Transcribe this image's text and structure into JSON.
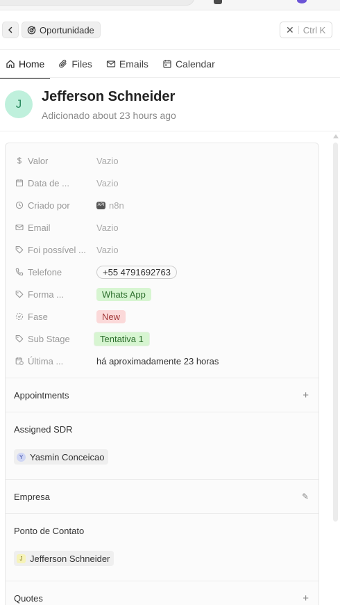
{
  "header": {
    "back_glyph": "‹",
    "breadcrumb_label": "Oportunidade",
    "close_glyph": "✕",
    "close_shortcut": "Ctrl K"
  },
  "tabs": [
    {
      "label": "Home",
      "icon": "home-icon"
    },
    {
      "label": "Files",
      "icon": "paperclip-icon"
    },
    {
      "label": "Emails",
      "icon": "mail-icon"
    },
    {
      "label": "Calendar",
      "icon": "calendar-icon"
    }
  ],
  "record": {
    "initial": "J",
    "name": "Jefferson Schneider",
    "subtitle": "Adicionado about 23 hours ago"
  },
  "fields": [
    {
      "label": "Valor",
      "value": "Vazio",
      "icon": "dollar-icon"
    },
    {
      "label": "Data de ...",
      "value": "Vazio",
      "icon": "calendar-icon"
    },
    {
      "label": "Criado por",
      "value": "n8n",
      "icon": "history-icon",
      "badge": "API"
    },
    {
      "label": "Email",
      "value": "Vazio",
      "icon": "mail-icon"
    },
    {
      "label": "Foi possível ...",
      "value": "Vazio",
      "icon": "tag-icon"
    },
    {
      "label": "Telefone",
      "value": "+55 4791692763",
      "icon": "phone-icon"
    },
    {
      "label": "Forma ...",
      "value": "Whats App",
      "icon": "tag-icon"
    },
    {
      "label": "Fase",
      "value": "New",
      "icon": "status-icon"
    },
    {
      "label": "Sub Stage",
      "value": "Tentativa 1",
      "icon": "tag-icon"
    },
    {
      "label": "Última ...",
      "value": "há aproximadamente 23 horas",
      "icon": "calendar-clock-icon"
    }
  ],
  "sections": {
    "appointments": {
      "title": "Appointments",
      "action": "+"
    },
    "assigned_sdr": {
      "title": "Assigned SDR",
      "person": "Yasmin Conceicao",
      "initial": "Y"
    },
    "empresa": {
      "title": "Empresa",
      "action": "✎"
    },
    "ponto_contato": {
      "title": "Ponto de Contato",
      "person": "Jefferson Schneider",
      "initial": "J"
    },
    "quotes": {
      "title": "Quotes",
      "action": "+"
    }
  },
  "colors": {
    "avatar_bg": "#bff0dc",
    "tag_green": "#d7f5d1",
    "tag_red": "#fbd9d9"
  }
}
